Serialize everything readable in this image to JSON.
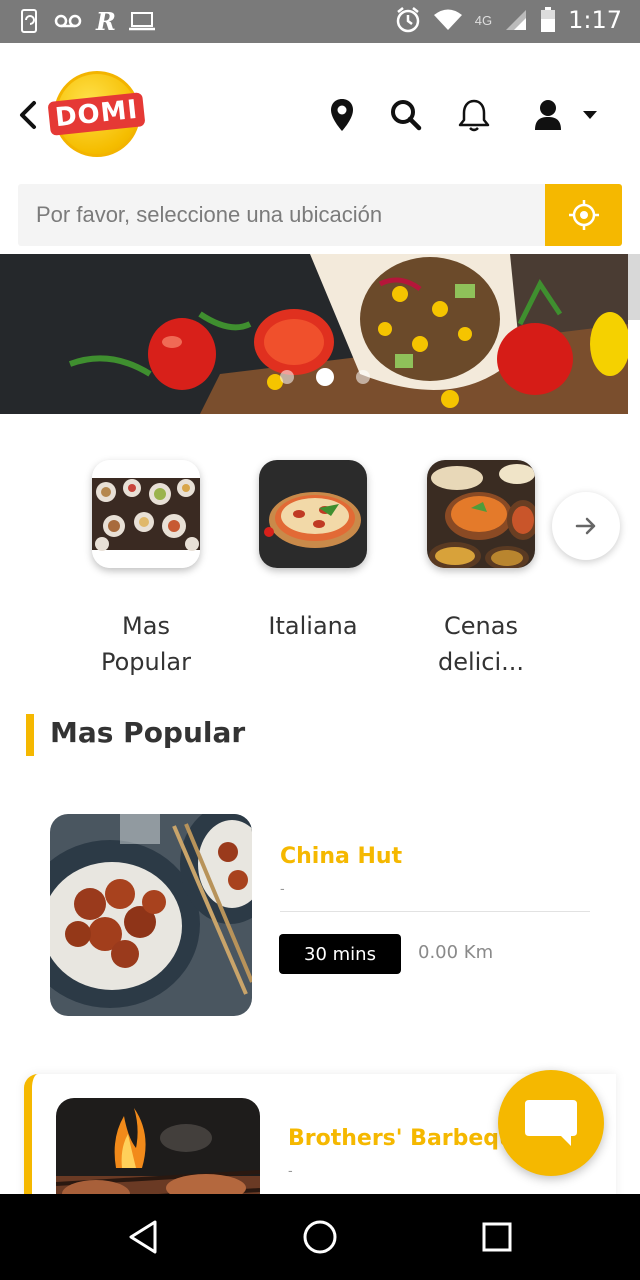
{
  "status_bar": {
    "time": "1:17",
    "network": "4G"
  },
  "header": {
    "logo_text": "DOMI",
    "icons": [
      "back-arrow-icon",
      "location-pin-icon",
      "search-icon",
      "bell-icon",
      "user-icon",
      "caret-down-icon"
    ]
  },
  "location": {
    "placeholder": "Por favor, seleccione una ubicación"
  },
  "banner": {
    "slides": 3,
    "active_slide": 2
  },
  "categories": [
    {
      "label": "Mas Popular"
    },
    {
      "label": "Italiana"
    },
    {
      "label": "Cenas delici..."
    }
  ],
  "section": {
    "title": "Mas Popular"
  },
  "restaurants": [
    {
      "name": "China Hut",
      "subtitle": "-",
      "time": "30 mins",
      "distance": "0.00 Km"
    },
    {
      "name": "Brothers' Barbeque",
      "subtitle": "-"
    }
  ],
  "colors": {
    "accent": "#f5b800",
    "status_bar": "#7a7a7a",
    "badge": "#000000"
  }
}
